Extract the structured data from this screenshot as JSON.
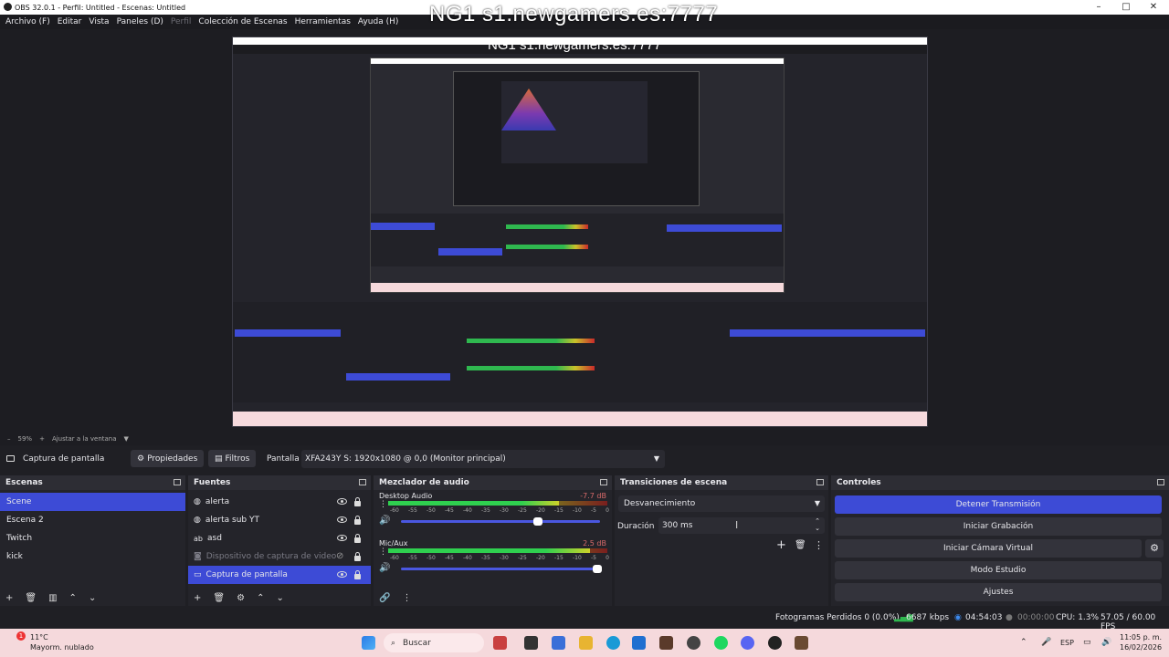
{
  "window": {
    "title": "OBS 32.0.1 - Perfil: Untitled - Escenas: Untitled",
    "watermark": "NG1 s1.newgamers.es:7777"
  },
  "menu": [
    "Archivo (F)",
    "Editar",
    "Vista",
    "Paneles (D)",
    "Perfil",
    "Colección de Escenas",
    "Herramientas",
    "Ayuda (H)"
  ],
  "zoombar": {
    "zoom": "59%",
    "fit": "Ajustar a la ventana"
  },
  "source_toolbar": {
    "source_name": "Captura de pantalla",
    "properties": "Propiedades",
    "filters": "Filtros",
    "display_label": "Pantalla",
    "display_value": "XFA243Y S: 1920x1080 @ 0,0 (Monitor principal)"
  },
  "scenes": {
    "title": "Escenas",
    "items": [
      "Scene",
      "Escena 2",
      "Twitch",
      "kick"
    ],
    "selected": "Scene"
  },
  "sources": {
    "title": "Fuentes",
    "items": [
      {
        "label": "alerta",
        "icon": "browser-icon"
      },
      {
        "label": "alerta sub YT",
        "icon": "browser-icon"
      },
      {
        "label": "asd",
        "icon": "text-icon"
      },
      {
        "label": "Dispositivo de captura de video",
        "icon": "camera-icon"
      },
      {
        "label": "Captura de pantalla",
        "icon": "monitor-icon"
      }
    ]
  },
  "mixer": {
    "title": "Mezclador de audio",
    "channels": [
      {
        "name": "Desktop Audio",
        "db": "-7.7 dB",
        "level": 0.78,
        "volume": 0.7
      },
      {
        "name": "Mic/Aux",
        "db": "2.5 dB",
        "level": 0.92,
        "volume": 1.0
      }
    ],
    "ticks": [
      "-60",
      "-55",
      "-50",
      "-45",
      "-40",
      "-35",
      "-30",
      "-25",
      "-20",
      "-15",
      "-10",
      "-5",
      "0"
    ]
  },
  "transitions": {
    "title": "Transiciones de escena",
    "selected": "Desvanecimiento",
    "duration_label": "Duración",
    "duration_value": "300 ms"
  },
  "controls": {
    "title": "Controles",
    "buttons": [
      "Detener Transmisión",
      "Iniciar Grabación",
      "Iniciar Cámara Virtual",
      "Modo Estudio",
      "Ajustes"
    ]
  },
  "status": {
    "dropped": "Fotogramas Perdidos 0 (0.0%)",
    "kbps": "6687 kbps",
    "stream_time": "04:54:03",
    "rec_time": "00:00:00",
    "cpu": "CPU: 1.3%",
    "fps": "57.05 / 60.00 FPS"
  },
  "taskbar": {
    "weather_temp": "11°C",
    "weather_desc": "Mayorm. nublado",
    "search": "Buscar",
    "lang": "ESP",
    "time": "11:05 p. m.",
    "date": "16/02/2026"
  },
  "colors": {
    "accent": "#3d4bd6",
    "panel": "#24242a",
    "taskbar": "#f5d9dc"
  }
}
